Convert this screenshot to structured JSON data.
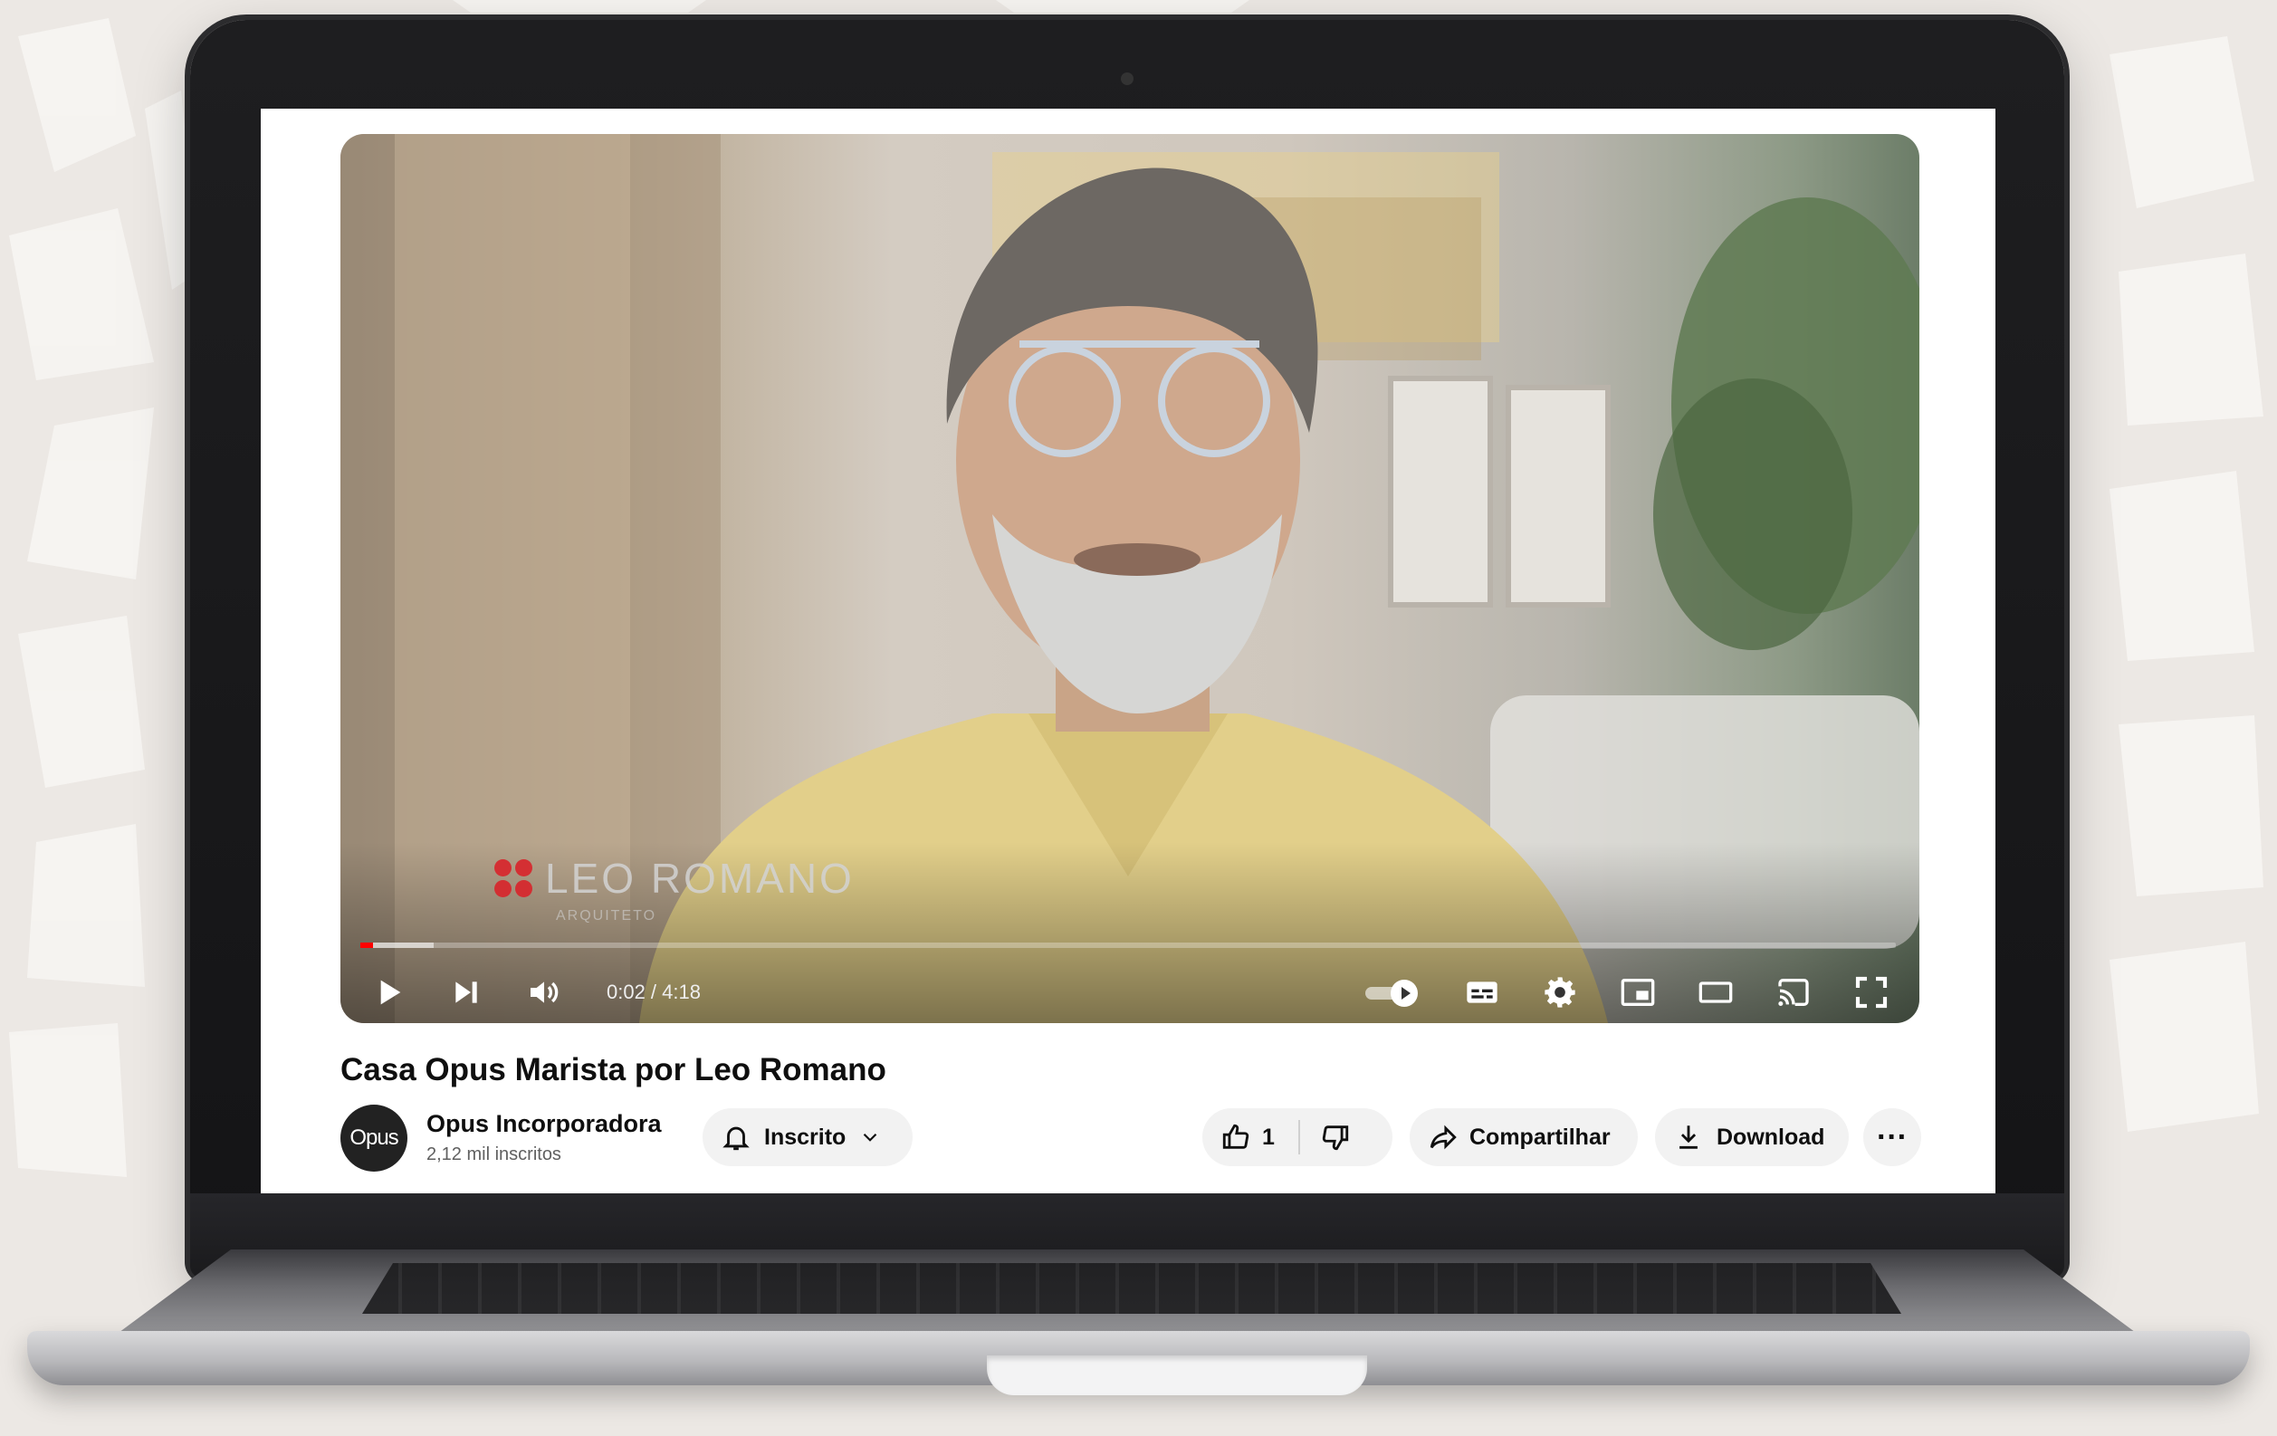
{
  "video": {
    "watermark_name": "LEO ROMANO",
    "watermark_sub": "ARQUITETO",
    "time_display": "0:02 / 4:18",
    "progress_fraction": 0.008,
    "buffer_fraction": 0.048,
    "controls": [
      "play",
      "next",
      "volume",
      "autoplay",
      "subtitles",
      "settings",
      "miniplayer",
      "theater",
      "cast",
      "fullscreen"
    ]
  },
  "title": "Casa Opus Marista por Leo Romano",
  "channel": {
    "avatar_text": "Opus",
    "name": "Opus Incorporadora",
    "subscribers": "2,12 mil inscritos"
  },
  "actions": {
    "subscribe_label": "Inscrito",
    "like_count": "1",
    "share_label": "Compartilhar",
    "download_label": "Download",
    "more_label": "···"
  },
  "colors": {
    "progress": "#ff0000",
    "watermark_logo": "#d8232a"
  }
}
